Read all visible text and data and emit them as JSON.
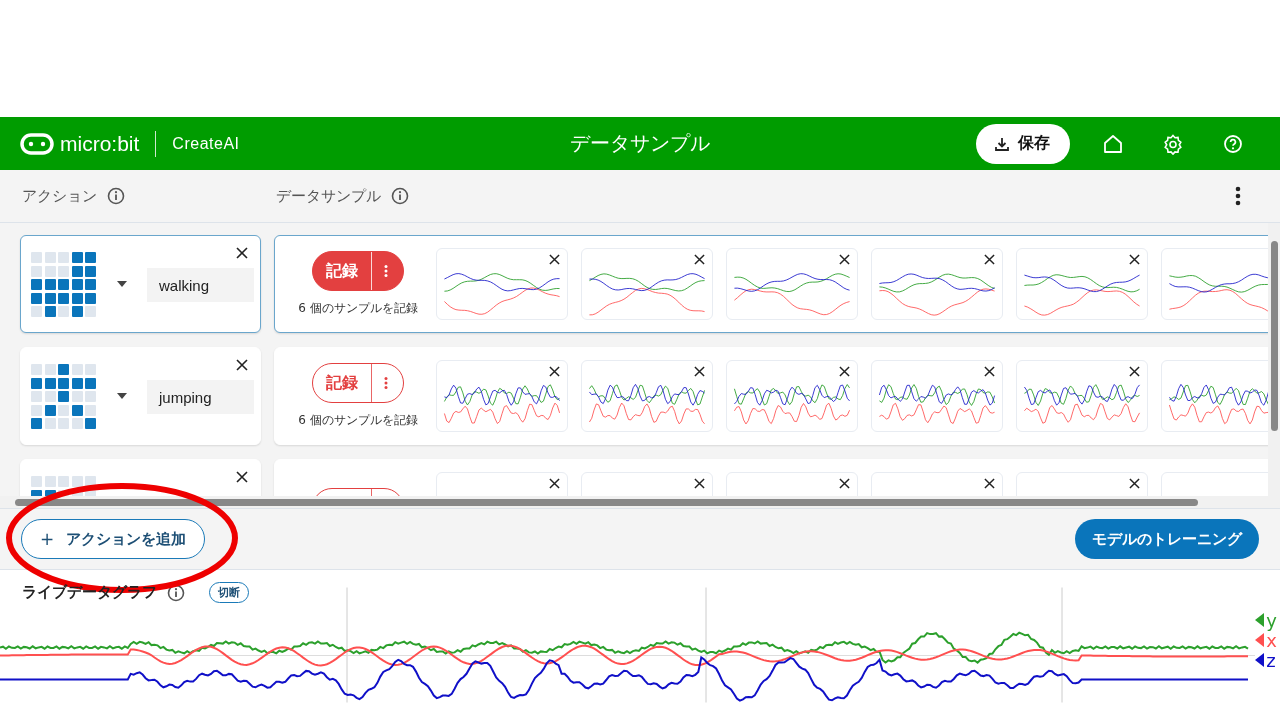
{
  "header": {
    "logo": "micro:bit",
    "product": "CreateAI",
    "title": "データサンプル",
    "save_button": "保存"
  },
  "columns": {
    "actions": "アクション",
    "samples": "データサンプル"
  },
  "actions": [
    {
      "name": "walking",
      "selected": true,
      "leds": [
        [
          false,
          false,
          false,
          true,
          true
        ],
        [
          false,
          false,
          false,
          true,
          true
        ],
        [
          true,
          true,
          true,
          true,
          true
        ],
        [
          true,
          true,
          true,
          true,
          true
        ],
        [
          false,
          true,
          false,
          true,
          false
        ]
      ],
      "record_button": "記録",
      "sample_count": "6 個のサンプルを記録",
      "samples": [
        {
          "kind": "wave"
        },
        {
          "kind": "wave"
        },
        {
          "kind": "wave"
        },
        {
          "kind": "wave"
        },
        {
          "kind": "wave"
        },
        {
          "kind": "wave_edge"
        }
      ]
    },
    {
      "name": "jumping",
      "selected": false,
      "leds": [
        [
          false,
          false,
          true,
          false,
          false
        ],
        [
          true,
          true,
          true,
          true,
          true
        ],
        [
          false,
          false,
          true,
          false,
          false
        ],
        [
          false,
          true,
          false,
          true,
          false
        ],
        [
          true,
          false,
          false,
          false,
          true
        ]
      ],
      "record_button": "記録",
      "sample_count": "6 個のサンプルを記録",
      "samples": [
        {
          "kind": "wave"
        },
        {
          "kind": "wave"
        },
        {
          "kind": "wave"
        },
        {
          "kind": "wave"
        },
        {
          "kind": "wave"
        },
        {
          "kind": "wave_edge"
        }
      ]
    },
    {
      "selected": false,
      "leds": [
        [
          false,
          false,
          false,
          false,
          false
        ],
        [
          true,
          true,
          false,
          false,
          false
        ]
      ],
      "samples": [
        {
          "kind": "blank"
        },
        {
          "kind": "blank"
        },
        {
          "kind": "blank"
        },
        {
          "kind": "blank"
        },
        {
          "kind": "blank"
        },
        {
          "kind": "blank_edge"
        }
      ]
    }
  ],
  "add_action_button": "アクションを追加",
  "add_icon": "+",
  "train_button": "モデルのトレーニング",
  "live_graph": {
    "title": "ライブデータグラフ",
    "status": "切断",
    "axes": [
      {
        "label": "y",
        "color": "#2ca02c"
      },
      {
        "label": "x",
        "color": "#ff5050"
      },
      {
        "label": "z",
        "color": "#1010c8"
      }
    ]
  },
  "annotation": {
    "kind": "ellipse",
    "color": "#ee0000"
  }
}
